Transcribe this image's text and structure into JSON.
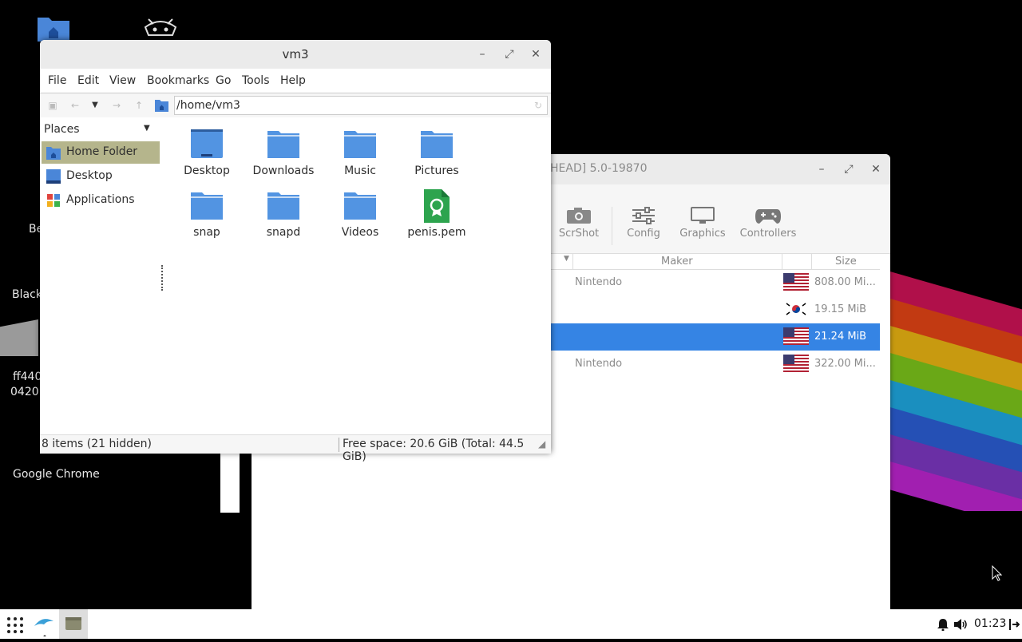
{
  "desktop": {
    "labels": [
      "Be",
      "Black",
      "ff440",
      "0420",
      "Google Chrome"
    ],
    "icons": [
      "home-folder-icon",
      "retroarch-icon"
    ]
  },
  "dolphin_window": {
    "title": "HEAD] 5.0-19870",
    "toolbar": [
      {
        "label": "ScrShot",
        "icon": "camera-icon"
      },
      {
        "label": "Config",
        "icon": "sliders-icon"
      },
      {
        "label": "Graphics",
        "icon": "monitor-icon"
      },
      {
        "label": "Controllers",
        "icon": "gamepad-icon"
      }
    ],
    "columns": {
      "maker": "Maker",
      "size": "Size"
    },
    "rows": [
      {
        "maker": "Nintendo",
        "flag": "us-flag-icon",
        "size": "808.00 Mi...",
        "selected": false
      },
      {
        "maker": "",
        "flag": "kr-flag-icon",
        "size": "19.15 MiB",
        "selected": false
      },
      {
        "maker": "",
        "flag": "us-flag-icon",
        "size": "21.24 MiB",
        "selected": true
      },
      {
        "maker": "Nintendo",
        "flag": "us-flag-icon",
        "size": "322.00 Mi...",
        "selected": false
      }
    ]
  },
  "file_manager": {
    "title": "vm3",
    "menu": [
      "File",
      "Edit",
      "View",
      "Bookmarks",
      "Go",
      "Tools",
      "Help"
    ],
    "path": "/home/vm3",
    "sidebar": {
      "header": "Places",
      "items": [
        {
          "label": "Home Folder",
          "icon": "home-folder-icon",
          "active": true
        },
        {
          "label": "Desktop",
          "icon": "desktop-icon",
          "active": false
        },
        {
          "label": "Applications",
          "icon": "applications-icon",
          "active": false
        }
      ]
    },
    "files": [
      {
        "name": "Desktop",
        "icon": "desktop-folder-icon"
      },
      {
        "name": "Downloads",
        "icon": "folder-icon"
      },
      {
        "name": "Music",
        "icon": "folder-icon"
      },
      {
        "name": "Pictures",
        "icon": "folder-icon"
      },
      {
        "name": "snap",
        "icon": "folder-icon"
      },
      {
        "name": "snapd",
        "icon": "folder-icon"
      },
      {
        "name": "Videos",
        "icon": "folder-icon"
      },
      {
        "name": "penis.pem",
        "icon": "certificate-file-icon"
      }
    ],
    "status_left": "8 items (21 hidden)",
    "status_right": "Free space: 20.6 GiB (Total: 44.5 GiB)"
  },
  "taskbar": {
    "clock": "01:23",
    "apps": [
      "app-grid-icon",
      "dolphin-app-icon",
      "file-manager-app-icon"
    ],
    "tray": [
      "bell-icon",
      "volume-icon",
      "logout-icon"
    ]
  },
  "colors": {
    "selection": "#3584e4",
    "folder": "#5294e2",
    "sidebar_active": "#b5b58c"
  }
}
